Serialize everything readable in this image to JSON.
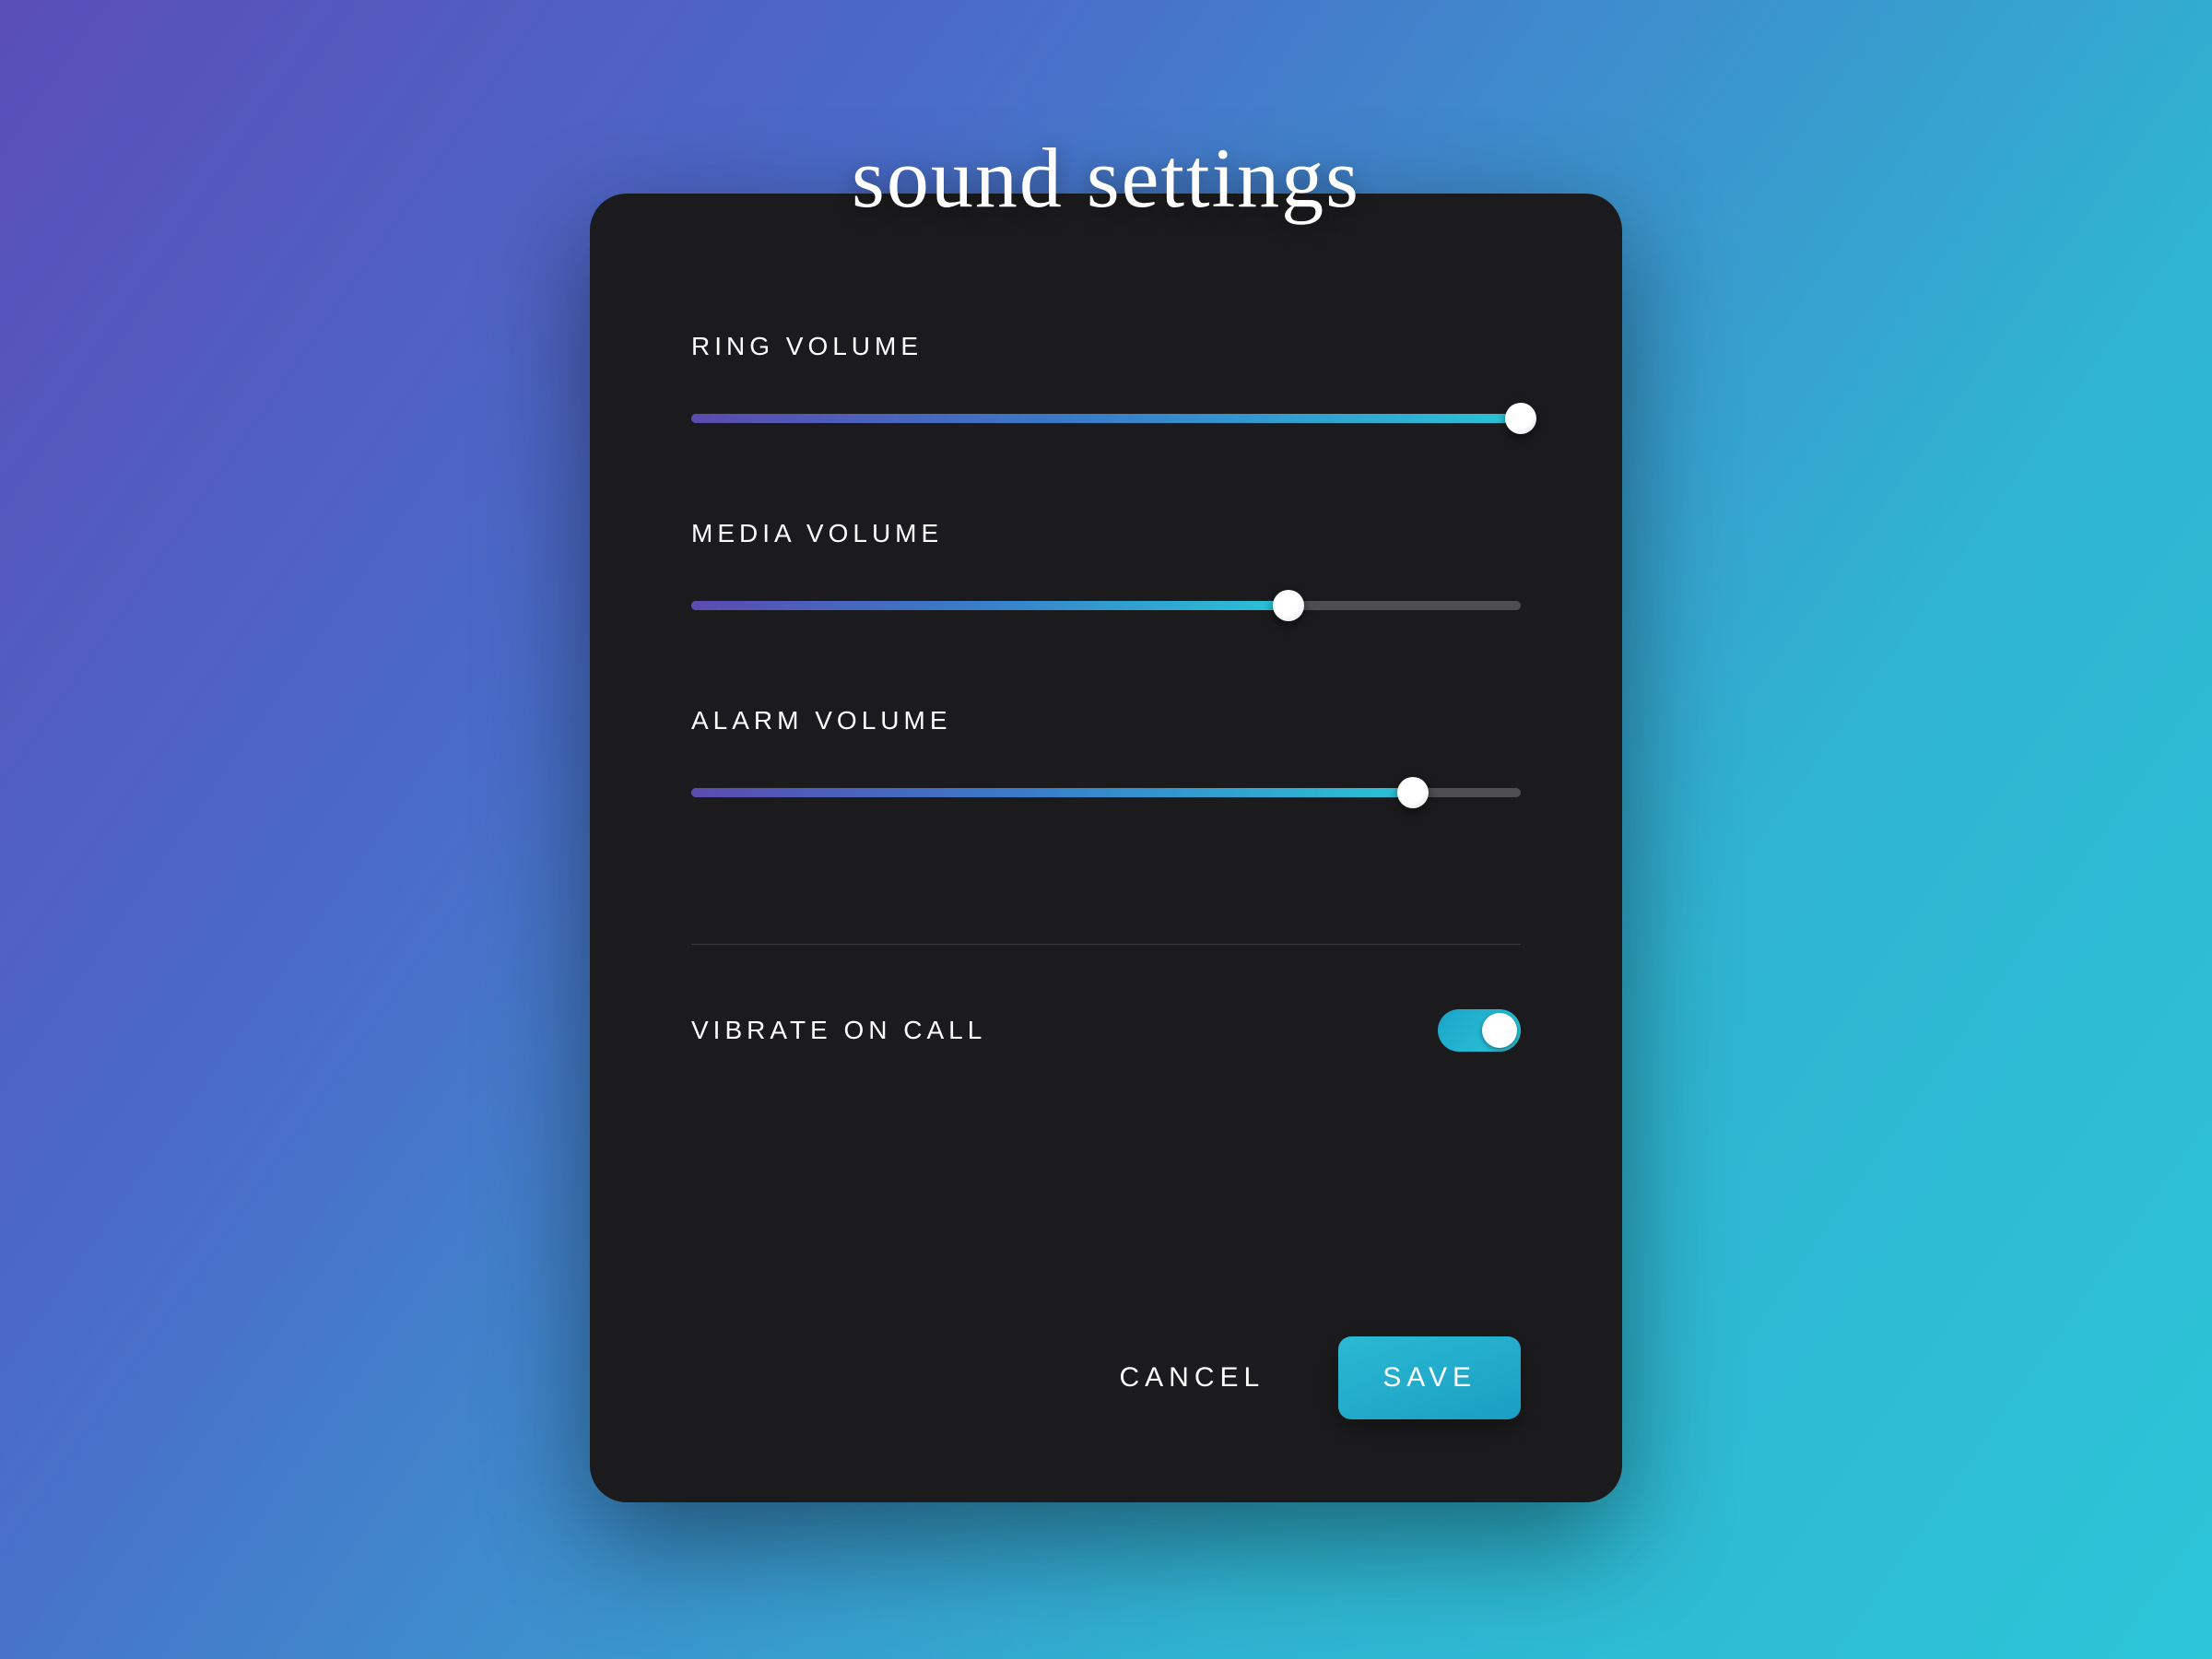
{
  "title": "sound settings",
  "sliders": [
    {
      "label": "RING VOLUME",
      "value": 100
    },
    {
      "label": "MEDIA VOLUME",
      "value": 72
    },
    {
      "label": "ALARM VOLUME",
      "value": 87
    }
  ],
  "toggle": {
    "label": "VIBRATE ON CALL",
    "on": true
  },
  "actions": {
    "cancel": "CANCEL",
    "save": "SAVE"
  },
  "colors": {
    "card": "#1b1b1d",
    "accentFrom": "#5b4bb0",
    "accentTo": "#29c3d6",
    "toggleOn": "#2cc5d8"
  }
}
